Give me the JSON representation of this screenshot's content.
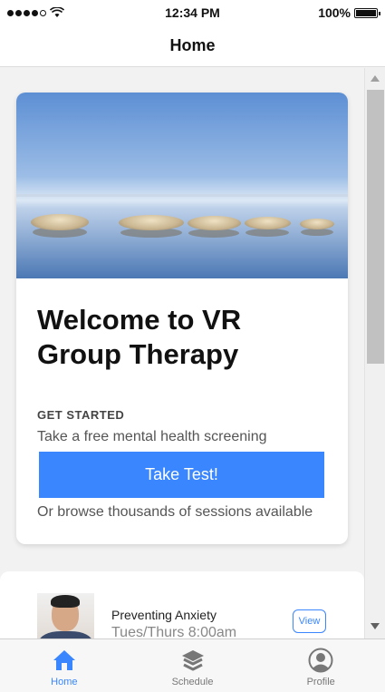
{
  "status_bar": {
    "time": "12:34 PM",
    "battery": "100%"
  },
  "nav": {
    "title": "Home"
  },
  "welcome_card": {
    "title": "Welcome to VR Group Therapy",
    "section_label": "GET STARTED",
    "description": "Take a free mental health screening",
    "button_label": "Take Test!",
    "browse_text": "Or browse thousands of sessions available"
  },
  "session": {
    "title": "Preventing Anxiety",
    "time": "Tues/Thurs 8:00am",
    "view_label": "View"
  },
  "tabs": [
    {
      "label": "Home",
      "icon": "home-icon",
      "active": true
    },
    {
      "label": "Schedule",
      "icon": "layers-icon",
      "active": false
    },
    {
      "label": "Profile",
      "icon": "profile-icon",
      "active": false
    }
  ],
  "colors": {
    "accent": "#3a86ff",
    "inactive": "#777777"
  }
}
